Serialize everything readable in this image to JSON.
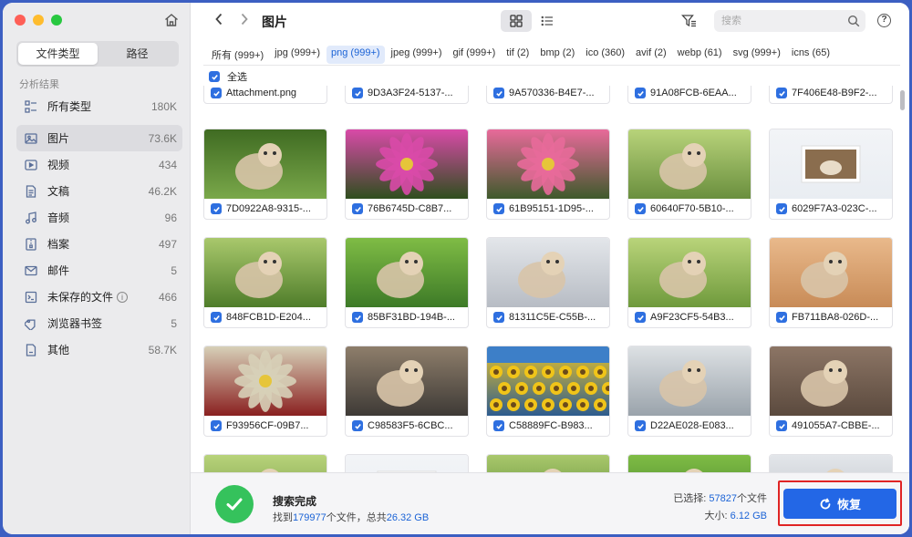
{
  "sidebar": {
    "segments": [
      "文件类型",
      "路径"
    ],
    "section_title": "分析结果",
    "categories": [
      {
        "label": "所有类型",
        "count": "180K",
        "icon": "all-types-icon"
      },
      {
        "label": "图片",
        "count": "73.6K",
        "icon": "image-icon"
      },
      {
        "label": "视频",
        "count": "434",
        "icon": "video-icon"
      },
      {
        "label": "文稿",
        "count": "46.2K",
        "icon": "document-icon"
      },
      {
        "label": "音频",
        "count": "96",
        "icon": "music-icon"
      },
      {
        "label": "档案",
        "count": "497",
        "icon": "archive-icon"
      },
      {
        "label": "邮件",
        "count": "5",
        "icon": "mail-icon"
      },
      {
        "label": "未保存的文件",
        "count": "466",
        "icon": "unsaved-file-icon"
      },
      {
        "label": "浏览器书签",
        "count": "5",
        "icon": "bookmark-tag-icon"
      },
      {
        "label": "其他",
        "count": "58.7K",
        "icon": "other-icon"
      }
    ]
  },
  "header": {
    "title": "图片",
    "search_placeholder": "搜索",
    "help": "?"
  },
  "tabs": [
    "所有 (999+)",
    "jpg (999+)",
    "png (999+)",
    "jpeg (999+)",
    "gif (999+)",
    "tif (2)",
    "bmp (2)",
    "ico (360)",
    "avif (2)",
    "webp (61)",
    "svg (999+)",
    "icns (65)"
  ],
  "select_all": "全选",
  "top_row": [
    "Attachment.png",
    "9D3A3F24-5137-...",
    "9A570336-B4E7-...",
    "91A08FCB-6EAA...",
    "7F406E48-B9F2-..."
  ],
  "rows": [
    [
      "7D0922A8-9315-...",
      "76B6745D-C8B7...",
      "61B95151-1D95-...",
      "60640F70-5B10-...",
      "6029F7A3-023C-..."
    ],
    [
      "848FCB1D-E204...",
      "85BF31BD-194B-...",
      "81311C5E-C55B-...",
      "A9F23CF5-54B3...",
      "FB711BA8-026D-..."
    ],
    [
      "F93956CF-09B7...",
      "C98583F5-6CBC...",
      "C58889FC-B983...",
      "D22AE028-E083...",
      "491055A7-CBBE-..."
    ]
  ],
  "bottom": {
    "done_title": "搜索完成",
    "found_prefix": "找到",
    "found_count": "179977",
    "found_mid": "个文件，总共",
    "found_size": "26.32 GB",
    "selected_prefix": "已选择:",
    "selected_count": "57827",
    "selected_suffix": "个文件",
    "size_label": "大小:",
    "size_value": "6.12 GB",
    "recover_label": "恢复"
  }
}
